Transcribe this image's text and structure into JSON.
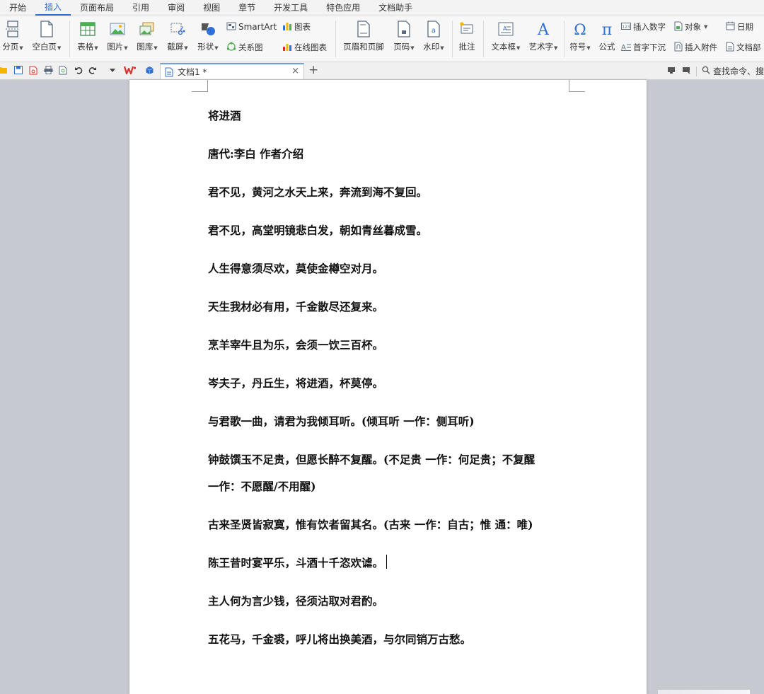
{
  "menu": {
    "tabs": [
      "开始",
      "插入",
      "页面布局",
      "引用",
      "审阅",
      "视图",
      "章节",
      "开发工具",
      "特色应用",
      "文档助手"
    ],
    "active": "插入"
  },
  "ribbon": {
    "page_break": "分页",
    "blank_page": "空白页",
    "table": "表格",
    "picture": "图片",
    "gallery": "图库",
    "screenshot": "截屏",
    "shape": "形状",
    "smartart": "SmartArt",
    "relation": "关系图",
    "chart": "图表",
    "online_chart": "在线图表",
    "header_footer": "页眉和页脚",
    "page_number": "页码",
    "watermark": "水印",
    "comment": "批注",
    "textbox": "文本框",
    "wordart": "艺术字",
    "symbol": "符号",
    "formula": "公式",
    "insert_number": "插入数字",
    "object": "对象",
    "date": "日期",
    "dropcap": "首字下沉",
    "attachment": "插入附件",
    "doc_parts": "文档部"
  },
  "docbar": {
    "tab_title": "文档1 *",
    "search_text": "查找命令、搜"
  },
  "document": {
    "paragraphs": [
      "将进酒",
      "唐代:李白 作者介绍",
      "君不见，黄河之水天上来，奔流到海不复回。",
      "君不见，高堂明镜悲白发，朝如青丝暮成雪。",
      "人生得意须尽欢，莫使金樽空对月。",
      "天生我材必有用，千金散尽还复来。",
      "烹羊宰牛且为乐，会须一饮三百杯。",
      "岑夫子，丹丘生，将进酒，杯莫停。",
      "与君歌一曲，请君为我倾耳听。(倾耳听 一作：侧耳听)",
      "钟鼓馔玉不足贵，但愿长醉不复醒。(不足贵 一作：何足贵；不复醒",
      "一作：不愿醒/不用醒)",
      "古来圣贤皆寂寞，惟有饮者留其名。(古来 一作：自古；惟 通：唯)",
      "陈王昔时宴平乐，斗酒十千恣欢谑。",
      "主人何为言少钱，径须沽取对君酌。",
      "五花马，千金裘，呼儿将出换美酒，与尔同销万古愁。"
    ]
  },
  "colors": {
    "accent": "#2f6fd6",
    "workspace": "#c6c9d0",
    "page": "#ffffff",
    "wps_red": "#d9302c"
  }
}
